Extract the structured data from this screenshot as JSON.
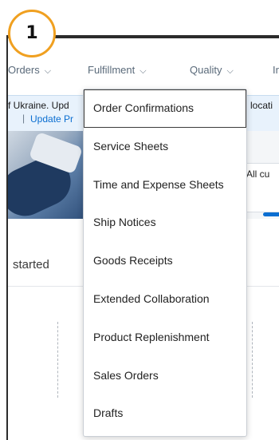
{
  "step_badge": {
    "number": "1",
    "color": "#f0a020"
  },
  "nav": {
    "orders": "Orders",
    "fulfillment": "Fulfillment",
    "quality": "Quality",
    "more": "In"
  },
  "banner": {
    "text": "f Ukraine. Upd",
    "link": "Update Pr",
    "right": "locati"
  },
  "hero_card_text": "All cu",
  "section": {
    "started": "started"
  },
  "dropdown": {
    "items": [
      "Order Confirmations",
      "Service Sheets",
      "Time and Expense Sheets",
      "Ship Notices",
      "Goods Receipts",
      "Extended Collaboration",
      "Product Replenishment",
      "Sales Orders",
      "Drafts"
    ],
    "focused_index": 0
  },
  "colors": {
    "accent": "#0a6ed1",
    "banner_bg": "#e8f2fc"
  }
}
